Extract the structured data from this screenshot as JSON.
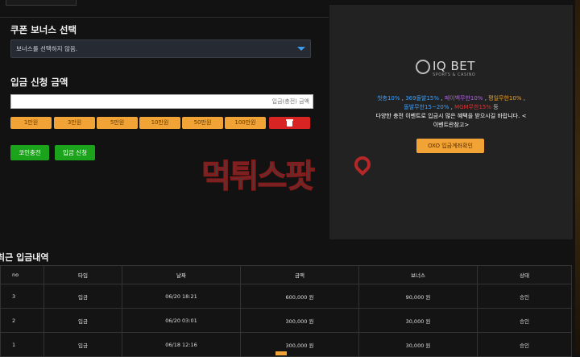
{
  "coupon": {
    "title": "쿠폰 보너스 선택",
    "select_value": "보너스를 선택하지 않음."
  },
  "deposit": {
    "title": "입금 신청 금액",
    "input_placeholder": "입금(충전) 금액",
    "amount_buttons": [
      "1만원",
      "3만원",
      "5만원",
      "10만원",
      "50만원",
      "100만원"
    ],
    "coin_button": "코인충전",
    "apply_button": "입금 신청"
  },
  "promo": {
    "logo_name": "IQ BET",
    "logo_sub": "SPORTS & CASINO",
    "line1": [
      {
        "text": "첫충10%",
        "color": "#3aa0ff"
      },
      {
        "text": " , ",
        "color": "#cccccc"
      },
      {
        "text": "369돌발15%",
        "color": "#3aa0ff"
      },
      {
        "text": " , ",
        "color": "#cccccc"
      },
      {
        "text": "페이백무한10%",
        "color": "#b060e0"
      },
      {
        "text": " , ",
        "color": "#cccccc"
      },
      {
        "text": "평일무한10%",
        "color": "#f0a020"
      },
      {
        "text": " ,",
        "color": "#cccccc"
      }
    ],
    "line2": [
      {
        "text": "돌발무한15~20%",
        "color": "#3aa0ff"
      },
      {
        "text": " , ",
        "color": "#cccccc"
      },
      {
        "text": "MGM무한15%",
        "color": "#e03030"
      },
      {
        "text": " 등",
        "color": "#cccccc"
      }
    ],
    "line3": "다양한 충전 이벤트로 입금시 많은 혜택을 받으시길 바랍니다. <",
    "line4": "이벤트란참고>",
    "oxo_button": "OXO 입금계좌확인"
  },
  "watermark": {
    "text": "먹튀스팟"
  },
  "history": {
    "title": "최근 입금내역",
    "columns": [
      "no",
      "타입",
      "날짜",
      "금액",
      "보너스",
      "상태"
    ],
    "rows": [
      [
        "3",
        "입금",
        "06/20 18:21",
        "600,000 원",
        "90,000 원",
        "승인"
      ],
      [
        "2",
        "입금",
        "06/20 03:01",
        "300,000 원",
        "30,000 원",
        "승인"
      ],
      [
        "1",
        "입금",
        "06/18 12:16",
        "300,000 원",
        "30,000 원",
        "승인"
      ]
    ]
  },
  "colors": {
    "accent_orange": "#f1a435",
    "danger_red": "#d92424",
    "success_green": "#1ba31b",
    "select_caret": "#3d9be9"
  }
}
